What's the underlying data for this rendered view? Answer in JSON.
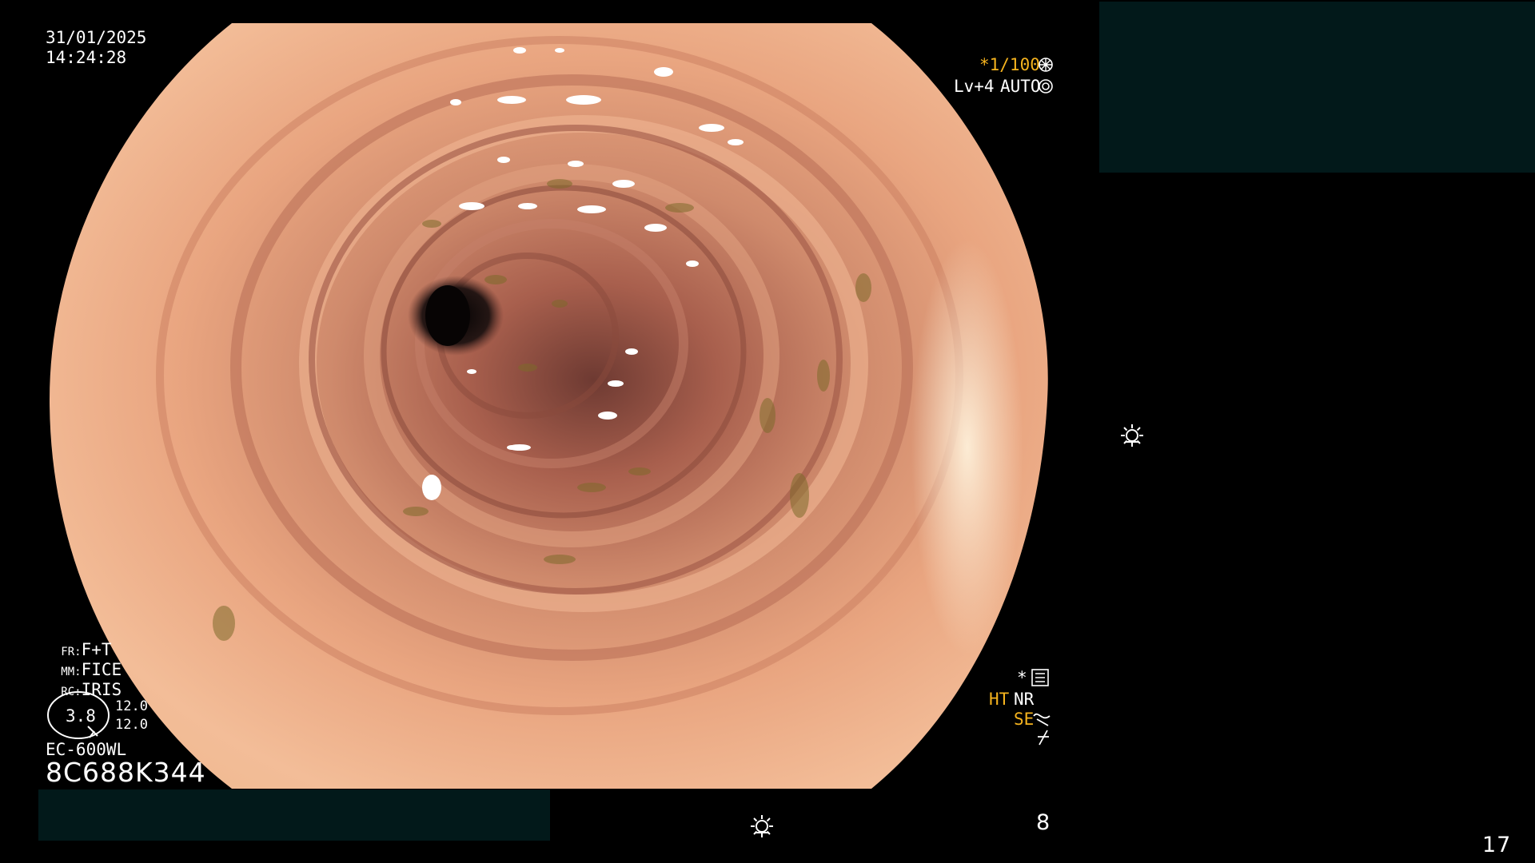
{
  "overlay": {
    "date": "31/01/2025",
    "time": "14:24:28",
    "shutter": "*1/100",
    "light": {
      "level": "Lv+4",
      "mode": "AUTO"
    },
    "fr": {
      "key": "FR:",
      "value": "F+T"
    },
    "mm": {
      "key": "MM:",
      "value": "FICE"
    },
    "rc": {
      "key": "RC:",
      "value": "IRIS"
    },
    "gauge": {
      "value": "3.8",
      "top": "12.0",
      "bottom": "12.0"
    },
    "scope_model": "EC-600WL",
    "serial": "8C688K344",
    "status_star": "*",
    "ht": "HT",
    "nr": "NR",
    "se": "SE",
    "bottom_number": "8",
    "corner_number": "17"
  },
  "icons": [
    "gear-icon",
    "light-icon",
    "menu-icon",
    "wave-icon",
    "slash-icon",
    "brightness-icon",
    "brightness-icon"
  ],
  "colors": {
    "accent": "#f5b31e",
    "panel": "#02191a"
  }
}
